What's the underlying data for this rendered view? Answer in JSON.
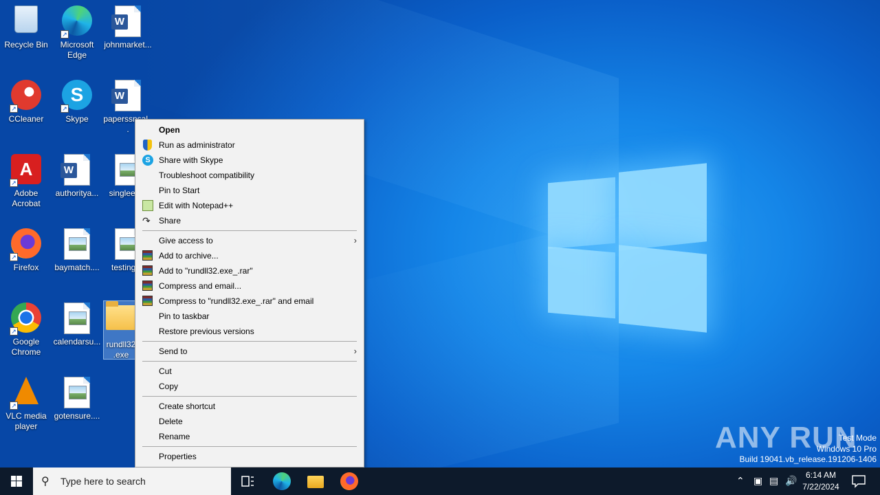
{
  "desktop_icons": [
    {
      "label": "Recycle Bin",
      "icon": "recycle-bin-icon"
    },
    {
      "label": "Microsoft Edge",
      "icon": "edge-icon"
    },
    {
      "label": "johnmarket...",
      "icon": "word-document-icon"
    },
    {
      "label": "CCleaner",
      "icon": "ccleaner-icon"
    },
    {
      "label": "Skype",
      "icon": "skype-icon"
    },
    {
      "label": "paperssnsal...",
      "icon": "word-document-icon"
    },
    {
      "label": "Adobe Acrobat",
      "icon": "acrobat-icon"
    },
    {
      "label": "authoritya...",
      "icon": "word-document-icon"
    },
    {
      "label": "singleed...",
      "icon": "image-file-icon"
    },
    {
      "label": "Firefox",
      "icon": "firefox-icon"
    },
    {
      "label": "baymatch....",
      "icon": "image-file-icon"
    },
    {
      "label": "testingi...",
      "icon": "image-file-icon"
    },
    {
      "label": "Google Chrome",
      "icon": "chrome-icon"
    },
    {
      "label": "calendarsu...",
      "icon": "image-file-icon"
    },
    {
      "label": "rundll32 .exe",
      "icon": "folder-icon"
    },
    {
      "label": "VLC media player",
      "icon": "vlc-icon"
    },
    {
      "label": "gotensure....",
      "icon": "image-file-icon"
    }
  ],
  "context_menu": {
    "items": [
      {
        "label": "Open"
      },
      {
        "label": "Run as administrator"
      },
      {
        "label": "Share with Skype"
      },
      {
        "label": "Troubleshoot compatibility"
      },
      {
        "label": "Pin to Start"
      },
      {
        "label": "Edit with Notepad++"
      },
      {
        "label": "Share"
      },
      {
        "label": "Give access to"
      },
      {
        "label": "Add to archive..."
      },
      {
        "label": "Add to \"rundll32.exe_.rar\""
      },
      {
        "label": "Compress and email..."
      },
      {
        "label": "Compress to \"rundll32.exe_.rar\" and email"
      },
      {
        "label": "Pin to taskbar"
      },
      {
        "label": "Restore previous versions"
      },
      {
        "label": "Send to"
      },
      {
        "label": "Cut"
      },
      {
        "label": "Copy"
      },
      {
        "label": "Create shortcut"
      },
      {
        "label": "Delete"
      },
      {
        "label": "Rename"
      },
      {
        "label": "Properties"
      }
    ]
  },
  "watermark": {
    "brand": "ANY RUN"
  },
  "system_info": {
    "line1": "Test Mode",
    "line2": "Windows 10 Pro",
    "line3": "Build 19041.vb_release.191206-1406"
  },
  "taskbar": {
    "search_placeholder": "Type here to search",
    "time": "6:14 AM",
    "date": "7/22/2024"
  },
  "colors": {
    "taskbar_bg": "#0d1a2b",
    "menu_bg": "#f2f2f2",
    "wallpaper_blue": "#0a5fc9"
  }
}
